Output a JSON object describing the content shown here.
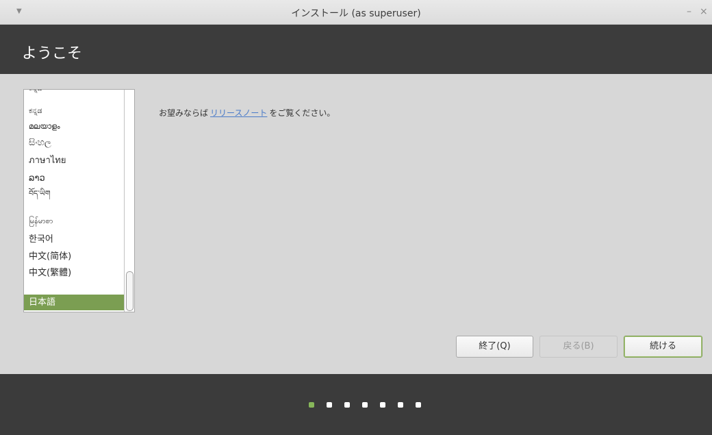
{
  "window": {
    "title": "インストール (as superuser)",
    "minimize": "–",
    "close": "×"
  },
  "header": {
    "heading": "ようこそ"
  },
  "language_list": {
    "items": [
      "ಕನ್ನಡ",
      "ಕನ್ನಡ",
      "മലയാളം",
      "සිංහල",
      "ภาษาไทย",
      "ລາວ",
      "བོད་ཡིག",
      "မြန်မာစာ",
      "한국어",
      "中文(简体)",
      "中文(繁體)",
      "日本語"
    ],
    "selected": "日本語"
  },
  "release": {
    "prefix": "お望みならば",
    "link": "リリースノート",
    "suffix": "をご覧ください。"
  },
  "buttons": {
    "quit": "終了(Q)",
    "back": "戻る(B)",
    "continue": "続ける"
  },
  "progress": {
    "total_steps": 7,
    "current_step": 1
  },
  "colors": {
    "accent": "#87b75a",
    "selection": "#7b9e52",
    "link": "#4a7bc8"
  }
}
